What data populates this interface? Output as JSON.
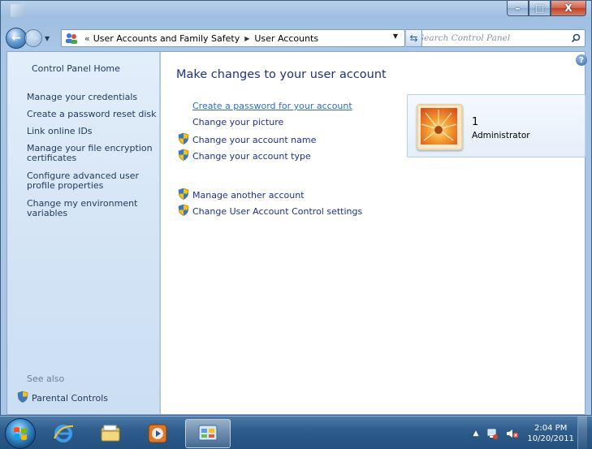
{
  "window": {
    "caption_buttons": {
      "minimize": "–",
      "maximize": "□",
      "close": "X"
    }
  },
  "nav": {
    "back_glyph": "←",
    "forward_glyph": "→",
    "address": {
      "overflow_chevron": "«",
      "crumbs": [
        "User Accounts and Family Safety",
        "User Accounts"
      ],
      "separator": "▶",
      "dropdown": "▼"
    },
    "refresh_glyph": "⇆",
    "search_placeholder": "Search Control Panel"
  },
  "sidebar": {
    "home": "Control Panel Home",
    "links": [
      "Manage your credentials",
      "Create a password reset disk",
      "Link online IDs",
      "Manage your file encryption certificates",
      "Configure advanced user profile properties",
      "Change my environment variables"
    ],
    "see_also": "See also",
    "parental_controls": "Parental Controls"
  },
  "main": {
    "help_glyph": "?",
    "title": "Make changes to your user account",
    "tasks": [
      "Create a password for your account",
      "Change your picture",
      "Change your account name",
      "Change your account type"
    ],
    "other_tasks": [
      "Manage another account",
      "Change User Account Control settings"
    ],
    "account": {
      "name": "1",
      "type": "Administrator"
    }
  },
  "taskbar": {
    "clock_time": "2:04 PM",
    "clock_date": "10/20/2011",
    "tray_chevron": "▲"
  },
  "colors": {
    "link": "#1e3287",
    "hover_link": "#2f6cc4",
    "sidebar_bg": "#d9e8f7",
    "taskbar": "#2f5d8c"
  }
}
